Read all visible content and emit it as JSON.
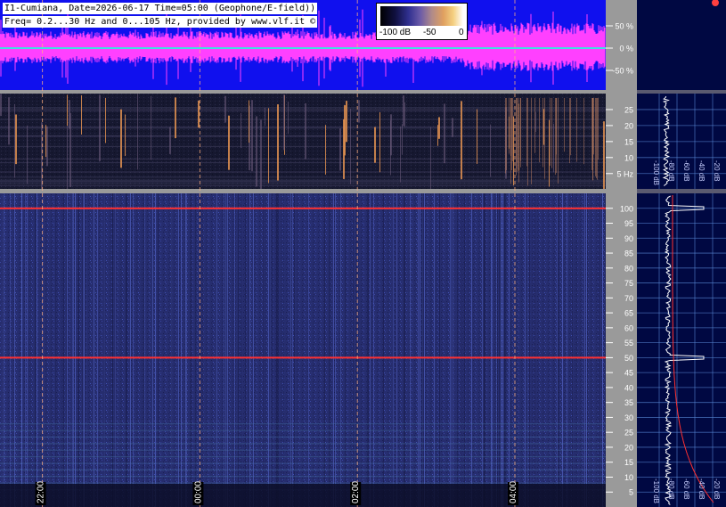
{
  "header": {
    "line1": "I1-Cumiana, Date=2026-06-17 Time=05:00 (Geophone/E-field))",
    "line2": "Freq= 0.2...30 Hz and 0...105 Hz, provided by www.vlf.it ©"
  },
  "colorbar": {
    "labels": [
      "-100 dB",
      "-50",
      "0"
    ]
  },
  "colors": {
    "waveform_bg": "#1010ee",
    "waveform_trace": "#ff40ff",
    "zero_line": "#40e0e0",
    "lf_spectrogram_bg": "#161830",
    "hf_spectrogram_bg": "#262d6e",
    "side_panel_bg": "#000842",
    "axis_strip": "#9a9a9a",
    "grid_line": "#5a8ad8",
    "marker_line": "#ff3030"
  },
  "chart_data": [
    {
      "type": "line",
      "name": "waveform",
      "ylabel": "",
      "ytick_labels": [
        "50 %",
        "0 %",
        "-50 %"
      ],
      "ylim": [
        -100,
        100
      ]
    },
    {
      "type": "heatmap",
      "name": "spectrogram-lf",
      "ytick_labels": [
        "25",
        "20",
        "15",
        "10",
        "5 Hz"
      ],
      "ytick_values": [
        25,
        20,
        15,
        10,
        5
      ],
      "ylim": [
        0.2,
        30
      ],
      "spectrum_xtick_labels": [
        "-100 dB",
        "-80 dB",
        "-60 dB",
        "-40 dB",
        "-20 dB"
      ]
    },
    {
      "type": "heatmap",
      "name": "spectrogram-hf",
      "ytick_labels": [
        "100",
        "95",
        "90",
        "85",
        "80",
        "75",
        "70",
        "65",
        "60",
        "55",
        "50",
        "45",
        "40",
        "35",
        "30",
        "25",
        "20",
        "15",
        "10",
        "5"
      ],
      "ytick_values": [
        100,
        95,
        90,
        85,
        80,
        75,
        70,
        65,
        60,
        55,
        50,
        45,
        40,
        35,
        30,
        25,
        20,
        15,
        10,
        5
      ],
      "ylim": [
        0,
        105
      ],
      "spectrum_xtick_labels": [
        "-100 dB",
        "-80 dB",
        "-60 dB",
        "-40 dB",
        "-20 dB"
      ],
      "highlighted_lines_hz": [
        100,
        50
      ]
    }
  ],
  "time_axis": {
    "labels": [
      "22:00",
      "00:00",
      "02:00",
      "04:00"
    ],
    "marker_positions": [
      0.07,
      0.33,
      0.59,
      0.85
    ],
    "hour_markers": [
      0.07,
      0.33,
      0.59,
      0.85
    ]
  }
}
